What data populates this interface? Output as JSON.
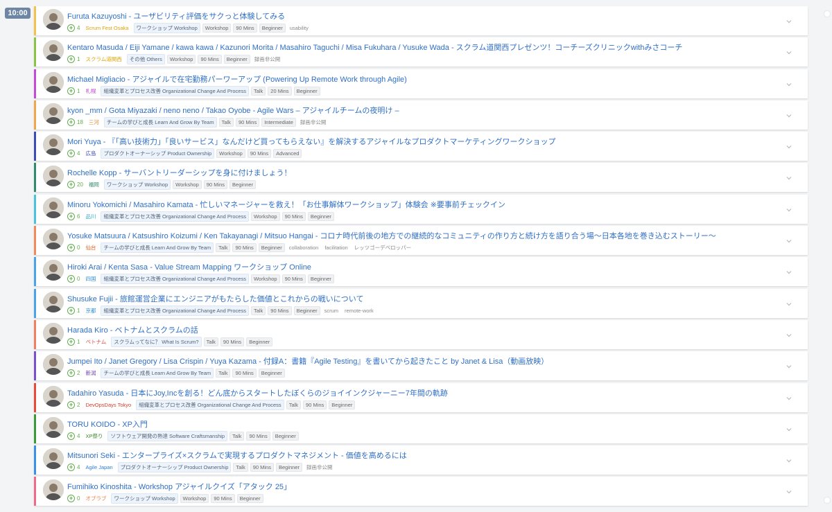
{
  "time_badge": "10:00",
  "sessions": [
    {
      "title": "Furuta Kazuyoshi - ユーザビリティ評価をサクっと体験してみる",
      "count": "4",
      "place": "Scrum Fest Osaka",
      "place_color": "#e0a000",
      "accent": "#f2c14e",
      "tags": [
        "ワークショップ Workshop",
        "Workshop",
        "90 Mins",
        "Beginner",
        "usability"
      ]
    },
    {
      "title": "Kentaro Masuda / Eiji Yamane / kawa kawa / Kazunori Morita / Masahiro Taguchi / Misa Fukuhara / Yusuke Wada - スクラム道関西プレゼンツ！コーチーズクリニックwithみさコーチ",
      "count": "1",
      "place": "スクラム道関西",
      "place_color": "#e0a000",
      "accent": "#8bc34a",
      "tags": [
        "その他 Others",
        "Workshop",
        "90 Mins",
        "Beginner",
        "録画非公開"
      ]
    },
    {
      "title": "Michael Migliacio - アジャイルで在宅勤務パーワーアップ (Powering Up Remote Work through Agile)",
      "count": "1",
      "place": "札幌",
      "place_color": "#c34ad6",
      "accent": "#c34ad6",
      "tags": [
        "組織変革とプロセス改善 Organizational Change And Process",
        "Talk",
        "20 Mins",
        "Beginner"
      ]
    },
    {
      "title": "kyon _mm / Gota Miyazaki / neno neno / Takao Oyobe - Agile Wars – アジャイルチームの夜明け –",
      "count": "18",
      "place": "三河",
      "place_color": "#e88b2a",
      "accent": "#f0a64a",
      "tags": [
        "チームの学びと成長 Learn And Grow By Team",
        "Talk",
        "90 Mins",
        "Intermediate",
        "録画非公開"
      ]
    },
    {
      "title": "Mori Yuya - 『「高い技術力」「良いサービス」なんだけど買ってもらえない』を解決するアジャイルなプロダクトマーケティングワークショップ",
      "count": "4",
      "place": "広島",
      "place_color": "#3b4db0",
      "accent": "#3b4db0",
      "tags": [
        "プロダクトオーナーシップ Product Ownership",
        "Workshop",
        "90 Mins",
        "Advanced"
      ]
    },
    {
      "title": "Rochelle Kopp - サーバントリーダーシップを身に付けましょう！",
      "count": "20",
      "place": "福岡",
      "place_color": "#2e8b6b",
      "accent": "#2e8b6b",
      "tags": [
        "ワークショップ Workshop",
        "Workshop",
        "90 Mins",
        "Beginner"
      ]
    },
    {
      "title": "Minoru Yokomichi / Masahiro Kamata - 忙しいマネージャーを救え！「お仕事解体ワークショップ」体験会 ※要事前チェックイン",
      "count": "6",
      "place": "品川",
      "place_color": "#2aa8c9",
      "accent": "#4cc3dd",
      "tags": [
        "組織変革とプロセス改善 Organizational Change And Process",
        "Workshop",
        "90 Mins",
        "Beginner"
      ]
    },
    {
      "title": "Yosuke Matsuura / Katsushiro Koizumi / Ken Takayanagi / Mitsuo Hangai - コロナ時代前後の地方での継続的なコミュニティの作り方と続け方を語り合う場〜日本各地を巻き込むストーリー〜",
      "count": "0",
      "place": "仙台",
      "place_color": "#e0611e",
      "accent": "#f08a5d",
      "tags": [
        "チームの学びと成長 Learn And Grow By Team",
        "Talk",
        "90 Mins",
        "Beginner",
        "collaboration",
        "facilitation",
        "レッツゴーデベロッパー"
      ]
    },
    {
      "title": "Hiroki Arai / Kenta Sasa - Value Stream Mapping ワークショップ Online",
      "count": "0",
      "place": "四国",
      "place_color": "#2b8fd6",
      "accent": "#4aa3e8",
      "tags": [
        "組織変革とプロセス改善 Organizational Change And Process",
        "Workshop",
        "90 Mins",
        "Beginner"
      ]
    },
    {
      "title": "Shusuke Fujii - 旅館運営企業にエンジニアがもたらした価値とこれからの戦いについて",
      "count": "1",
      "place": "京都",
      "place_color": "#2b8fd6",
      "accent": "#4aa3e8",
      "tags": [
        "組織変革とプロセス改善 Organizational Change And Process",
        "Talk",
        "90 Mins",
        "Beginner",
        "scrum",
        "remote-work"
      ]
    },
    {
      "title": "Harada Kiro - ベトナムとスクラムの話",
      "count": "1",
      "place": "ベトナム",
      "place_color": "#e04a3a",
      "accent": "#f08060",
      "tags": [
        "スクラムってなに？ What Is Scrum?",
        "Talk",
        "90 Mins",
        "Beginner"
      ]
    },
    {
      "title": "Jumpei Ito / Janet Gregory / Lisa Crispin / Yuya Kazama - 付録A：書籍『Agile Testing』を書いてから起きたこと by Janet & Lisa（動画放映）",
      "count": "2",
      "place": "新潟",
      "place_color": "#6a3fb8",
      "accent": "#7a4fc8",
      "tags": [
        "チームの学びと成長 Learn And Grow By Team",
        "Talk",
        "90 Mins",
        "Beginner"
      ]
    },
    {
      "title": "Tadahiro Yasuda - 日本にJoy,Incを創る！どん底からスタートしたぼくらのジョイインクジャーニー7年間の軌跡",
      "count": "2",
      "place": "DevOpsDays Tokyo",
      "place_color": "#d93a2a",
      "accent": "#e84a3a",
      "tags": [
        "組織変革とプロセス改善 Organizational Change And Process",
        "Talk",
        "90 Mins",
        "Beginner"
      ]
    },
    {
      "title": "TORU KOIDO - XP入門",
      "count": "4",
      "place": "XP祭り",
      "place_color": "#3a8a2a",
      "accent": "#3a9a3a",
      "tags": [
        "ソフトウェア開発の熟達 Software Craftsmanship",
        "Talk",
        "90 Mins",
        "Beginner"
      ]
    },
    {
      "title": "Mitsunori Seki - エンタープライズ×スクラムで実現するプロダクトマネジメント - 価値を高めるには",
      "count": "4",
      "place": "Agile Japan",
      "place_color": "#2b7fd6",
      "accent": "#3a8fe8",
      "tags": [
        "プロダクトオーナーシップ Product Ownership",
        "Talk",
        "90 Mins",
        "Beginner",
        "録画非公開"
      ]
    },
    {
      "title": "Fumihiko Kinoshita - Workshop アジャイルクイズ「アタック 25」",
      "count": "0",
      "place": "オブラブ",
      "place_color": "#f07a40",
      "accent": "#f06a8a",
      "tags": [
        "ワークショップ Workshop",
        "Workshop",
        "90 Mins",
        "Beginner"
      ]
    }
  ]
}
